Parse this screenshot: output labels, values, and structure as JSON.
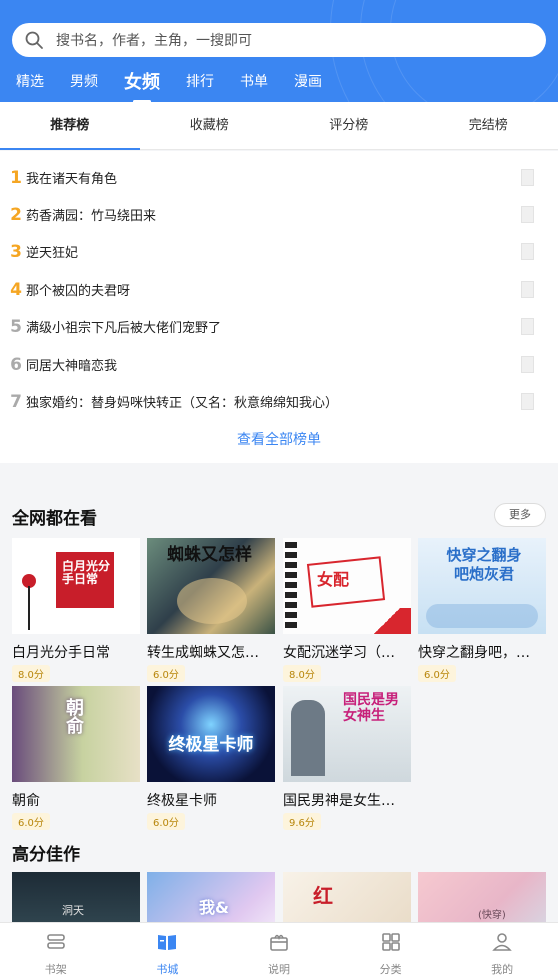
{
  "search": {
    "placeholder": "搜书名，作者，主角，一搜即可"
  },
  "channels": [
    "精选",
    "男频",
    "女频",
    "排行",
    "书单",
    "漫画"
  ],
  "rank_tabs": [
    "推荐榜",
    "收藏榜",
    "评分榜",
    "完结榜"
  ],
  "rank_list": [
    {
      "num": "1",
      "title": "我在诸天有角色"
    },
    {
      "num": "2",
      "title": "药香满园：竹马绕田来"
    },
    {
      "num": "3",
      "title": "逆天狂妃"
    },
    {
      "num": "4",
      "title": "那个被囚的夫君呀"
    },
    {
      "num": "5",
      "title": "满级小祖宗下凡后被大佬们宠野了"
    },
    {
      "num": "6",
      "title": "同居大神暗恋我"
    },
    {
      "num": "7",
      "title": "独家婚约：替身妈咪快转正（又名：秋意绵绵知我心）"
    }
  ],
  "rank_colors": {
    "top": "#f5a623",
    "rest": "#aaaaaa"
  },
  "view_all": "查看全部榜单",
  "section_hot": {
    "title": "全网都在看",
    "more": "更多"
  },
  "hot_books": [
    {
      "title": "白月光分手日常",
      "score": "8.0分",
      "cover_text": "白月光分手日常"
    },
    {
      "title": "转生成蜘蛛又怎…",
      "score": "6.0分",
      "cover_text": "蜘蛛又怎样"
    },
    {
      "title": "女配沉迷学习（…",
      "score": "8.0分",
      "cover_text": "女配"
    },
    {
      "title": "快穿之翻身吧，…",
      "score": "6.0分",
      "cover_text": "快穿之翻身吧炮灰君"
    },
    {
      "title": "朝俞",
      "score": "6.0分",
      "cover_text": "朝俞"
    },
    {
      "title": "终极星卡师",
      "score": "6.0分",
      "cover_text": "终极星卡师"
    },
    {
      "title": "国民男神是女生…",
      "score": "9.6分",
      "cover_text": "国民是男女神生"
    }
  ],
  "section_high": {
    "title": "高分佳作"
  },
  "high_books": [
    {
      "cover_text": "洞天"
    },
    {
      "cover_text": "我&"
    },
    {
      "cover_text": "红"
    },
    {
      "cover_text": "(快穿)"
    }
  ],
  "bottom_nav": [
    {
      "label": "书架",
      "icon": "bookshelf-icon"
    },
    {
      "label": "书城",
      "icon": "book-city-icon"
    },
    {
      "label": "说明",
      "icon": "gift-icon"
    },
    {
      "label": "分类",
      "icon": "category-grid-icon"
    },
    {
      "label": "我的",
      "icon": "user-icon"
    }
  ],
  "colors": {
    "accent": "#3b86f2",
    "header_bg": "#3b86f2"
  }
}
